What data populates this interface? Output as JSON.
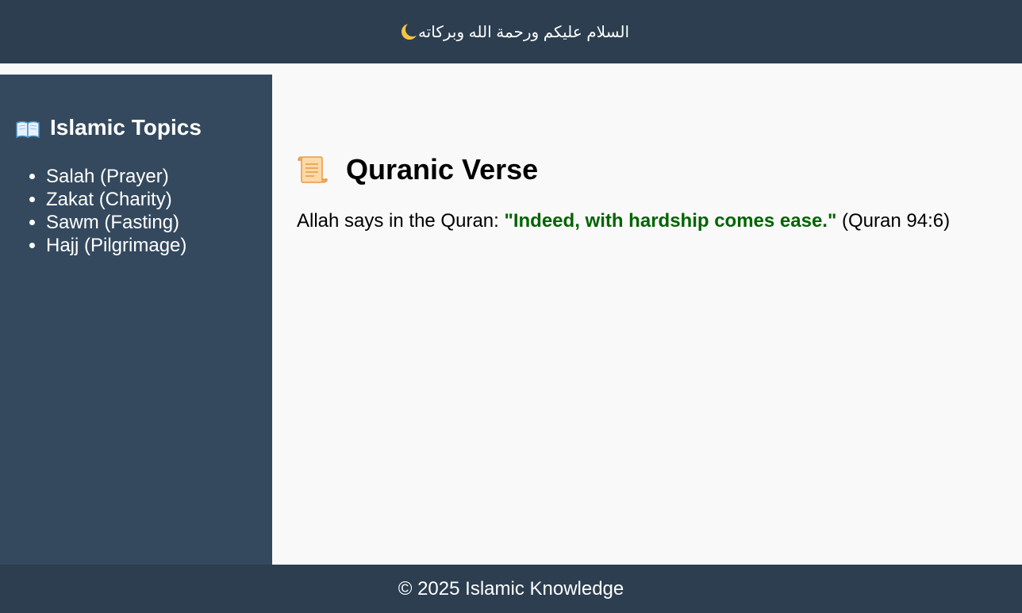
{
  "header": {
    "greeting": "السلام عليكم ورحمة الله وبركاته",
    "icon": "crescent-moon-icon"
  },
  "sidebar": {
    "title": "Islamic Topics",
    "title_icon": "open-book-icon",
    "items": [
      {
        "label": "Salah (Prayer)"
      },
      {
        "label": "Zakat (Charity)"
      },
      {
        "label": "Sawm (Fasting)"
      },
      {
        "label": "Hajj (Pilgrimage)"
      }
    ]
  },
  "main": {
    "title": "Quranic Verse",
    "title_icon": "scroll-icon",
    "intro": "Allah says in the Quran: ",
    "quote": "\"Indeed, with hardship comes ease.\"",
    "reference": " (Quran 94:6)"
  },
  "footer": {
    "text": "© 2025 Islamic Knowledge"
  },
  "colors": {
    "header_bg": "#2c3e50",
    "sidebar_bg": "#34495e",
    "main_bg": "#f9f9f9",
    "quote": "#006400",
    "text_light": "#ffffff"
  }
}
